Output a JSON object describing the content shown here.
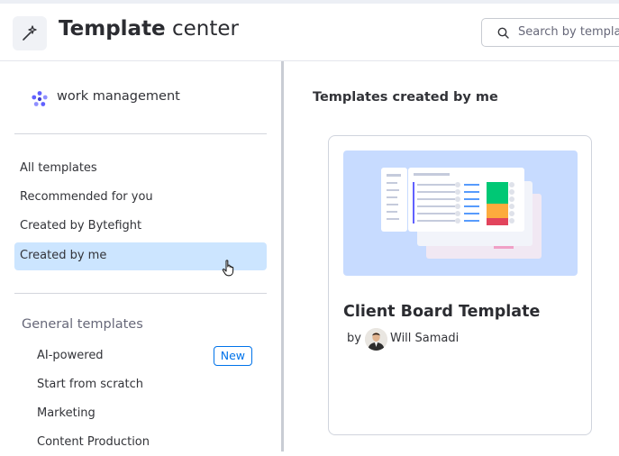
{
  "header": {
    "title_bold": "Template",
    "title_light": "center",
    "search_placeholder": "Search by templat"
  },
  "sidebar": {
    "workspace_label": "work management",
    "nav_items": [
      {
        "label": "All templates",
        "selected": false
      },
      {
        "label": "Recommended for you",
        "selected": false
      },
      {
        "label": "Created by Bytefight",
        "selected": false
      },
      {
        "label": "Created by me",
        "selected": true
      }
    ],
    "section_title": "General templates",
    "section_items": [
      {
        "label": "AI-powered",
        "badge": "New"
      },
      {
        "label": "Start from scratch",
        "badge": ""
      },
      {
        "label": "Marketing",
        "badge": ""
      },
      {
        "label": "Content Production",
        "badge": ""
      }
    ]
  },
  "main": {
    "section_title": "Templates created by me",
    "cards": [
      {
        "title": "Client Board Template",
        "by": "by",
        "author": "Will Samadi"
      }
    ]
  },
  "colors": {
    "selected_bg": "#cce5ff",
    "accent": "#0073ea",
    "thumb_bg": "#c7dbff"
  }
}
